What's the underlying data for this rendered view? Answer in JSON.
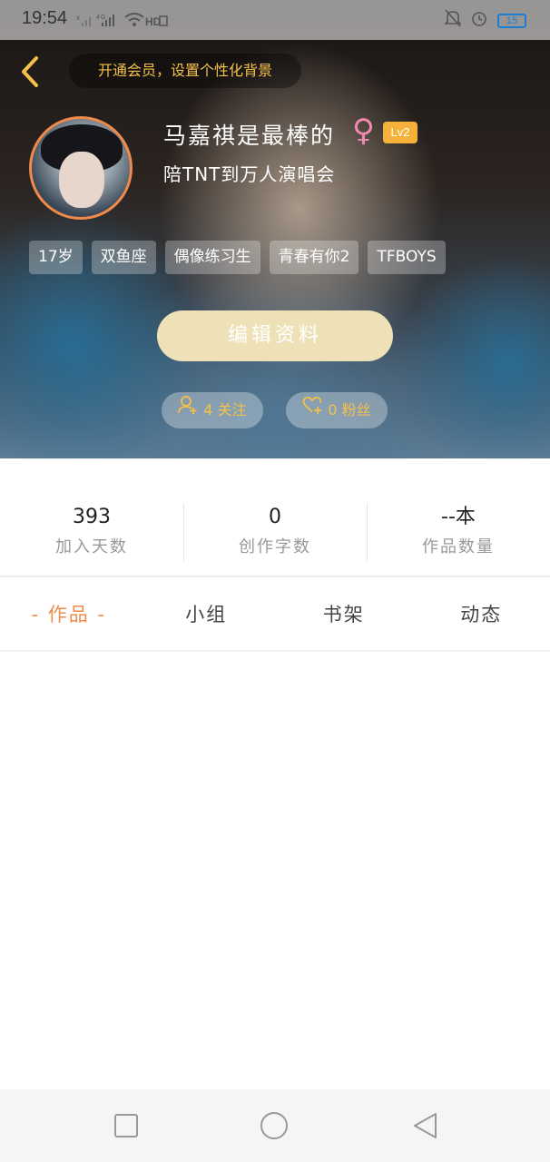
{
  "status_bar": {
    "time": "19:54",
    "signal_text": "4G",
    "wifi_text": "HD",
    "battery": "15"
  },
  "header": {
    "vip_prompt": "开通会员，设置个性化背景",
    "username": "马嘉祺是最棒的",
    "gender_symbol": "♀",
    "level": "Lv2",
    "signature": "陪TNT到万人演唱会",
    "tags": [
      "17岁",
      "双鱼座",
      "偶像练习生",
      "青春有你2",
      "TFBOYS"
    ],
    "edit_button": "编辑资料",
    "following_label": "4 关注",
    "fans_label": "0 粉丝"
  },
  "stats": [
    {
      "value": "393",
      "label": "加入天数"
    },
    {
      "value": "0",
      "label": "创作字数"
    },
    {
      "value": "--本",
      "label": "作品数量"
    }
  ],
  "tabs": [
    "- 作品 -",
    "小组",
    "书架",
    "动态"
  ],
  "colors": {
    "accent": "#f08a4b",
    "gold": "#f5c04a",
    "edit_button_bg": "#efe1b7"
  }
}
